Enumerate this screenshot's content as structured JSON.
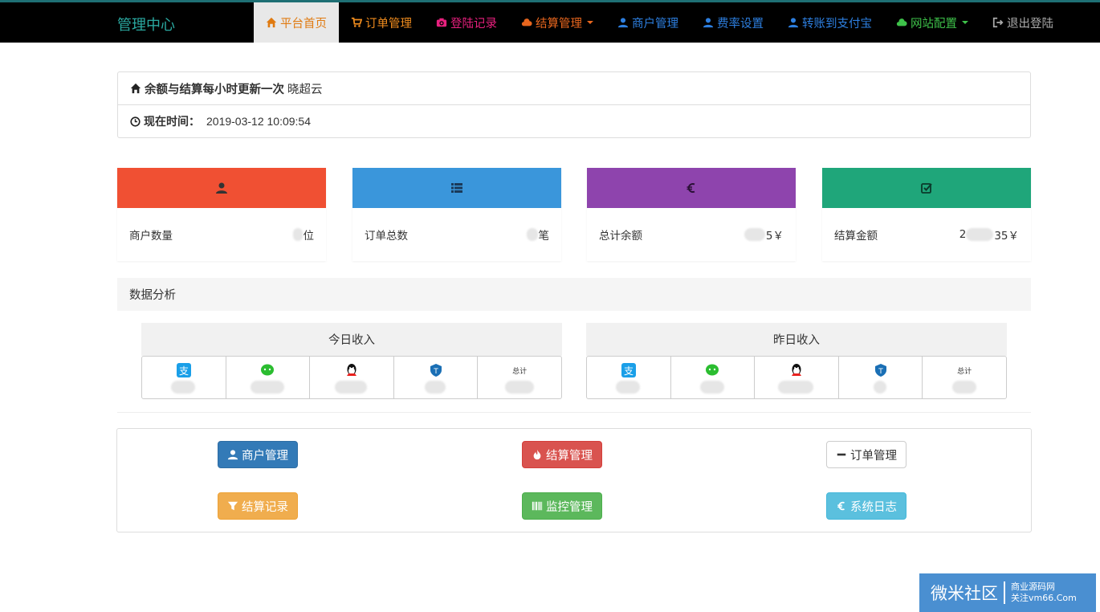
{
  "brand": "管理中心",
  "nav": {
    "items": [
      {
        "label": "平台首页",
        "color": "#e07a10",
        "icon": "home-icon"
      },
      {
        "label": "订单管理",
        "color": "#f08c1e",
        "icon": "cart-icon"
      },
      {
        "label": "登陆记录",
        "color": "#e8207e",
        "icon": "camera-icon"
      },
      {
        "label": "结算管理",
        "color": "#e8661e",
        "icon": "cloud-icon"
      },
      {
        "label": "商户管理",
        "color": "#2d7fe0",
        "icon": "user-icon"
      },
      {
        "label": "费率设置",
        "color": "#2d7fe0",
        "icon": "user-icon"
      },
      {
        "label": "转账到支付宝",
        "color": "#2d7fe0",
        "icon": "user-icon"
      },
      {
        "label": "网站配置",
        "color": "#3ec24a",
        "icon": "cloud-icon"
      },
      {
        "label": "退出登陆",
        "color": "#aaaaaa",
        "icon": "logout-icon"
      }
    ]
  },
  "info": {
    "headline": "余额与结算每小时更新一次",
    "headline_suffix": "晓超云",
    "time_label": "现在时间：",
    "time_value": "2019-03-12 10:09:54"
  },
  "cards": [
    {
      "label": "商户数量",
      "value_tail": "位",
      "color": "#f05033",
      "icon": "user-icon"
    },
    {
      "label": "订单总数",
      "value_tail": "笔",
      "color": "#3a96db",
      "icon": "list-icon"
    },
    {
      "label": "总计余额",
      "value_head": "",
      "value_tail": "5￥",
      "color": "#8e44ad",
      "icon": "euro-icon"
    },
    {
      "label": "结算金额",
      "value_head": "2",
      "value_tail": "35￥",
      "color": "#1fa67a",
      "icon": "check-square-icon"
    }
  ],
  "analysis": {
    "title": "数据分析",
    "today": "今日收入",
    "yesterday": "昨日收入",
    "total_label": "总计"
  },
  "buttons": [
    {
      "label": "商户管理",
      "color": "#337ab7",
      "icon": "user-icon"
    },
    {
      "label": "结算管理",
      "color": "#d9534f",
      "icon": "fire-icon"
    },
    {
      "label": "订单管理",
      "color": "#ffffff",
      "icon": "minus-icon"
    },
    {
      "label": "结算记录",
      "color": "#f0ad4e",
      "icon": "filter-icon"
    },
    {
      "label": "监控管理",
      "color": "#5cb85c",
      "icon": "barcode-icon"
    },
    {
      "label": "系统日志",
      "color": "#5bc0de",
      "icon": "euro-icon"
    }
  ],
  "watermark": {
    "main": "微米社区",
    "line1": "商业源码网",
    "line2": "关注vm66.Com"
  }
}
